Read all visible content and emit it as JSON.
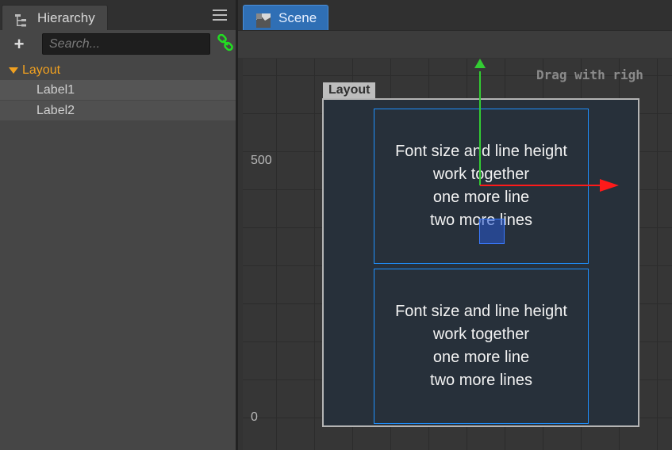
{
  "hierarchy": {
    "tab_label": "Hierarchy",
    "search_placeholder": "Search...",
    "tree": {
      "root": "Layout",
      "children": [
        "Label1",
        "Label2"
      ]
    }
  },
  "scene": {
    "tab_label": "Scene",
    "hint_text": "Drag with righ",
    "layout_tag": "Layout",
    "axis_labels": {
      "y500": "500",
      "y0": "0"
    },
    "labels": [
      {
        "text": "Font size and line height\nwork together\none more line\ntwo more lines"
      },
      {
        "text": "Font size and line height\nwork together\none more line\ntwo more lines"
      }
    ]
  },
  "colors": {
    "accent_orange": "#f0a020",
    "tab_active_blue": "#2f6fb5",
    "gizmo_x": "#ff1a1a",
    "gizmo_y": "#33cc33",
    "link_green": "#22dd22"
  },
  "icons": {
    "hierarchy_tab": "tree-icon",
    "menu": "menu-icon",
    "add": "plus-icon",
    "link": "link-icon",
    "scene_tab": "scene-icon"
  }
}
